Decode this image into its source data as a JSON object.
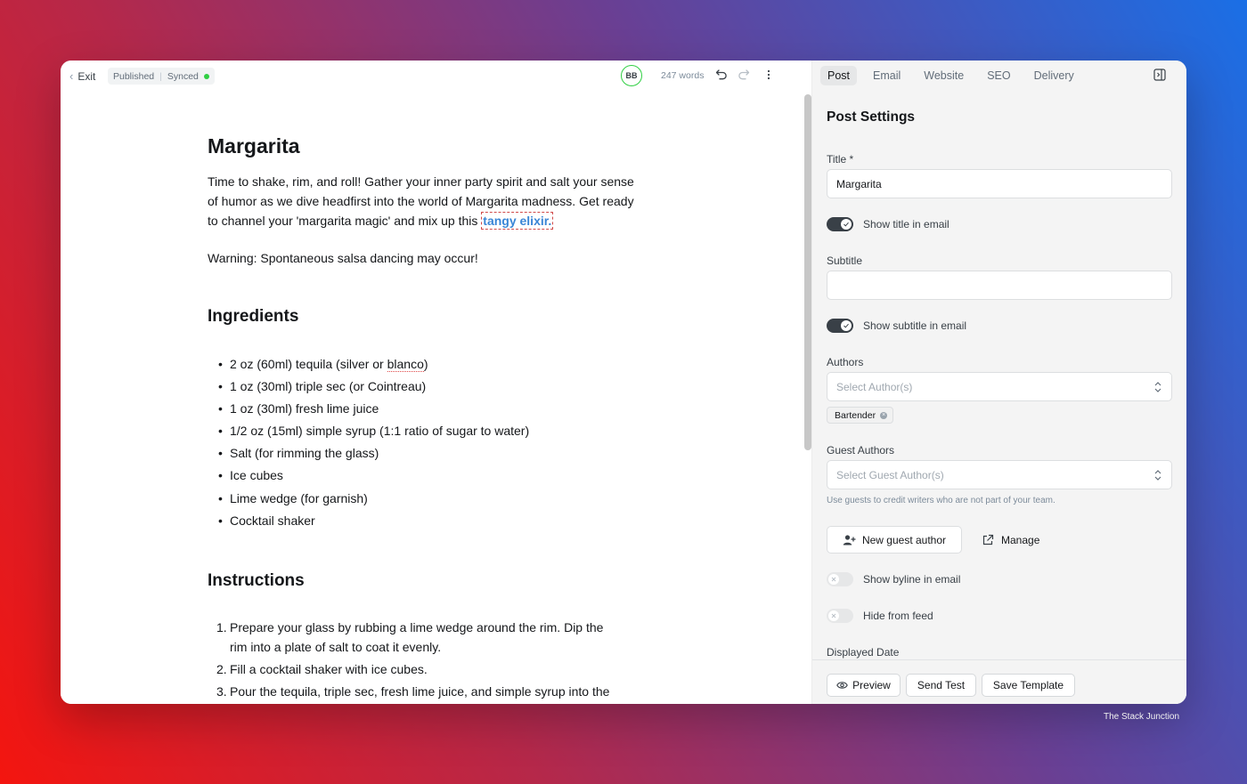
{
  "toolbar": {
    "exit_label": "Exit",
    "status_published": "Published",
    "status_synced": "Synced",
    "avatar_initials": "BB",
    "word_count": "247 words"
  },
  "article": {
    "title": "Margarita",
    "intro_part1": "Time to shake, rim, and roll! Gather your inner party spirit and salt your sense of humor as we dive headfirst into the world of Margarita madness. Get ready to channel your 'margarita magic' and mix up this ",
    "intro_highlight": "tangy elixir.",
    "warning": "Warning: Spontaneous salsa dancing may occur!",
    "ingredients_heading": "Ingredients",
    "ingredients": [
      {
        "before": "2 oz (60ml) tequila (silver or ",
        "spell": "blanco",
        "after": ")"
      },
      {
        "text": "1 oz (30ml) triple sec (or Cointreau)"
      },
      {
        "text": "1 oz (30ml) fresh lime juice"
      },
      {
        "text": "1/2 oz (15ml) simple syrup (1:1 ratio of sugar to water)"
      },
      {
        "text": "Salt (for rimming the glass)"
      },
      {
        "text": "Ice cubes"
      },
      {
        "text": "Lime wedge (for garnish)"
      },
      {
        "text": "Cocktail shaker"
      }
    ],
    "instructions_heading": "Instructions",
    "instructions": [
      {
        "num": "1.",
        "text": "Prepare your glass by rubbing a lime wedge around the rim. Dip the rim into a plate of salt to coat it evenly."
      },
      {
        "num": "2.",
        "text": "Fill a cocktail shaker with ice cubes."
      },
      {
        "num": "3.",
        "text": "Pour the tequila, triple sec, fresh lime juice, and simple syrup into the"
      }
    ]
  },
  "settings": {
    "tabs": [
      "Post",
      "Email",
      "Website",
      "SEO",
      "Delivery"
    ],
    "heading": "Post Settings",
    "title_label": "Title *",
    "title_value": "Margarita",
    "show_title_label": "Show title in email",
    "show_title_on": true,
    "subtitle_label": "Subtitle",
    "subtitle_value": "",
    "show_subtitle_label": "Show subtitle in email",
    "show_subtitle_on": true,
    "authors_label": "Authors",
    "authors_placeholder": "Select Author(s)",
    "author_chip": "Bartender",
    "guest_authors_label": "Guest Authors",
    "guest_authors_placeholder": "Select Guest Author(s)",
    "guest_hint": "Use guests to credit writers who are not part of your team.",
    "new_guest_label": "New guest author",
    "manage_label": "Manage",
    "show_byline_label": "Show byline in email",
    "show_byline_on": false,
    "hide_feed_label": "Hide from feed",
    "hide_feed_on": false,
    "displayed_date_label": "Displayed Date"
  },
  "footer": {
    "preview_label": "Preview",
    "send_test_label": "Send Test",
    "save_template_label": "Save Template"
  },
  "credit": "The Stack Junction",
  "colors": {
    "synced_dot": "#30cf43",
    "highlight_text": "#3a86d6",
    "toggle_on": "#394047"
  }
}
